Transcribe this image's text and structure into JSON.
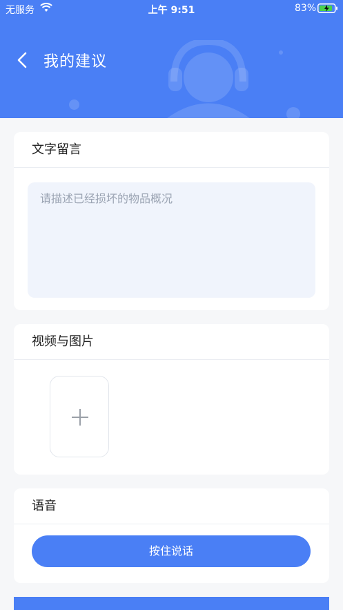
{
  "status_bar": {
    "carrier": "无服务",
    "time": "上午 9:51",
    "battery_percent": "83%"
  },
  "nav": {
    "title": "我的建议"
  },
  "text_section": {
    "title": "文字留言",
    "placeholder": "请描述已经损坏的物品概况"
  },
  "media_section": {
    "title": "视频与图片"
  },
  "voice_section": {
    "title": "语音",
    "button_label": "按住说话"
  },
  "colors": {
    "primary": "#4a7ff5",
    "background": "#f6f7f9",
    "input_bg": "#f0f4fc"
  }
}
